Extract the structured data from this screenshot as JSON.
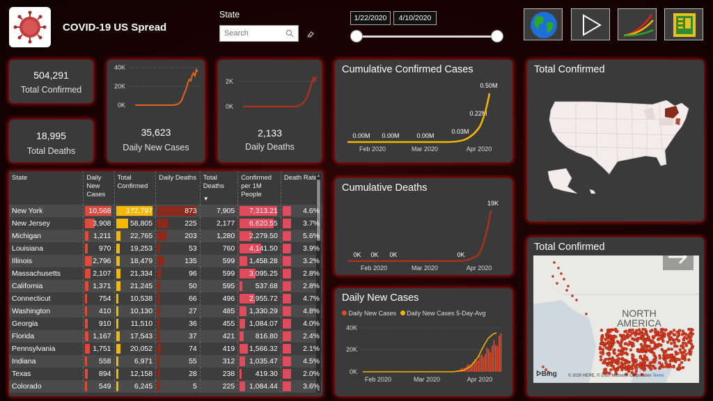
{
  "header": {
    "title": "COVID-19 US Spread",
    "state_label": "State",
    "search_placeholder": "Search",
    "date_start": "1/22/2020",
    "date_end": "4/10/2020"
  },
  "kpi": {
    "total_confirmed": {
      "value": "504,291",
      "label": "Total Confirmed"
    },
    "total_deaths": {
      "value": "18,995",
      "label": "Total Deaths"
    },
    "daily_new_cases": {
      "value": "35,623",
      "label": "Daily New Cases",
      "ticks": [
        "40K",
        "20K",
        "0K"
      ]
    },
    "daily_deaths": {
      "value": "2,133",
      "label": "Daily Deaths",
      "ticks": [
        "2K",
        "0K"
      ]
    }
  },
  "table": {
    "headers": [
      "State",
      "Daily New Cases",
      "Total Confirmed",
      "Daily Deaths",
      "Total Deaths",
      "Confirmed per 1M People",
      "Death Rate"
    ],
    "rows": [
      [
        "New York",
        "10,568",
        "172,797",
        "873",
        "7,905",
        "7,313.21",
        "4.6%"
      ],
      [
        "New Jersey",
        "3,908",
        "58,805",
        "225",
        "2,177",
        "6,620.55",
        "3.7%"
      ],
      [
        "Michigan",
        "1,211",
        "22,765",
        "203",
        "1,280",
        "2,279.50",
        "5.6%"
      ],
      [
        "Louisiana",
        "970",
        "19,253",
        "53",
        "760",
        "4,141.50",
        "3.9%"
      ],
      [
        "Illinois",
        "2,796",
        "18,479",
        "135",
        "599",
        "1,458.28",
        "3.2%"
      ],
      [
        "Massachusetts",
        "2,107",
        "21,334",
        "96",
        "599",
        "3,095.25",
        "2.8%"
      ],
      [
        "California",
        "1,371",
        "21,245",
        "50",
        "595",
        "537.68",
        "2.8%"
      ],
      [
        "Connecticut",
        "754",
        "10,538",
        "66",
        "496",
        "2,955.72",
        "4.7%"
      ],
      [
        "Washington",
        "410",
        "10,130",
        "27",
        "485",
        "1,330.29",
        "4.8%"
      ],
      [
        "Georgia",
        "910",
        "11,510",
        "36",
        "455",
        "1,084.07",
        "4.0%"
      ],
      [
        "Florida",
        "1,167",
        "17,543",
        "37",
        "421",
        "816.80",
        "2.4%"
      ],
      [
        "Pennsylvania",
        "1,751",
        "20,052",
        "74",
        "419",
        "1,566.32",
        "2.1%"
      ],
      [
        "Indiana",
        "558",
        "6,971",
        "55",
        "312",
        "1,035.47",
        "4.5%"
      ],
      [
        "Texas",
        "894",
        "12,158",
        "28",
        "238",
        "419.30",
        "2.0%"
      ],
      [
        "Colorado",
        "549",
        "6,245",
        "5",
        "225",
        "1,084.44",
        "3.6%"
      ]
    ]
  },
  "charts": {
    "cumulative_confirmed": {
      "title": "Cumulative Confirmed Cases",
      "data_labels": [
        "0.00M",
        "0.00M",
        "0.00M",
        "0.03M",
        "0.22M",
        "0.50M"
      ],
      "x_ticks": [
        "Feb 2020",
        "Mar 2020",
        "Apr 2020"
      ]
    },
    "cumulative_deaths": {
      "title": "Cumulative Deaths",
      "data_labels": [
        "0K",
        "0K",
        "0K",
        "0K",
        "19K"
      ],
      "x_ticks": [
        "Feb 2020",
        "Mar 2020",
        "Apr 2020"
      ]
    },
    "daily_new_cases": {
      "title": "Daily New Cases",
      "legend": [
        "Daily New Cases",
        "Daily New Cases 5-Day-Avg"
      ],
      "y_ticks": [
        "40K",
        "20K",
        "0K"
      ],
      "x_ticks": [
        "Feb 2020",
        "Mar 2020",
        "Apr 2020"
      ]
    }
  },
  "maps": {
    "filled_title": "Total Confirmed",
    "bubble_title": "Total Confirmed",
    "region_label_1": "NORTH",
    "region_label_2": "AMERICA",
    "attribution": "© 2020 HERE, © 2020 Microsoft Corporation",
    "terms": "Terms",
    "bing": "Bing"
  },
  "colors": {
    "background": "#1a0303",
    "panel": "#3a3a3a",
    "glow": "#be1414",
    "accent_red": "#e04040",
    "accent_orange": "#f5a623",
    "line_orange": "#e8641c",
    "line_dark": "#a8321c",
    "yellow": "#f5b800",
    "dark_red": "#8a2a1c"
  },
  "chart_data": [
    {
      "type": "line",
      "title": "Cumulative Confirmed Cases",
      "x": [
        "Feb 2020",
        "Mar 2020",
        "Apr 2020"
      ],
      "series": [
        {
          "values": [
            0,
            0,
            0,
            0.03,
            0.22,
            0.5
          ]
        }
      ],
      "data_labels": [
        "0.00M",
        "0.00M",
        "0.00M",
        "0.03M",
        "0.22M",
        "0.50M"
      ]
    },
    {
      "type": "line",
      "title": "Cumulative Deaths",
      "x": [
        "Feb 2020",
        "Mar 2020",
        "Apr 2020"
      ],
      "series": [
        {
          "values": [
            0,
            0,
            0,
            0,
            19
          ]
        }
      ],
      "data_labels": [
        "0K",
        "0K",
        "0K",
        "0K",
        "19K"
      ]
    },
    {
      "type": "bar",
      "title": "Daily New Cases",
      "x": [
        "Feb 2020",
        "Mar 2020",
        "Apr 2020"
      ],
      "ylim": [
        0,
        40000
      ],
      "series": [
        {
          "name": "Daily New Cases"
        },
        {
          "name": "Daily New Cases 5-Day-Avg"
        }
      ]
    }
  ]
}
